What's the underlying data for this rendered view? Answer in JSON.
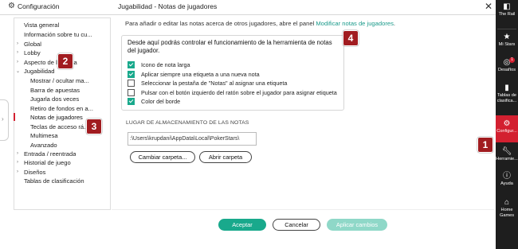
{
  "app": {
    "title": "Configuración",
    "gear_icon": "gear-icon"
  },
  "window": {
    "title": "Jugabilidad - Notas de jugadores",
    "close": "✕"
  },
  "sidebar": {
    "items": [
      {
        "label": "Vista general"
      },
      {
        "label": "Información sobre tu cu..."
      },
      {
        "label": "Global"
      },
      {
        "label": "Lobby"
      },
      {
        "label": "Aspecto de la mesa"
      },
      {
        "label": "Jugabilidad"
      },
      {
        "label": "Mostrar / ocultar ma..."
      },
      {
        "label": "Barra de apuestas"
      },
      {
        "label": "Jugarla dos veces"
      },
      {
        "label": "Retiro de fondos en a..."
      },
      {
        "label": "Notas de jugadores"
      },
      {
        "label": "Teclas de acceso rá..."
      },
      {
        "label": "Multimesa"
      },
      {
        "label": "Avanzado"
      },
      {
        "label": "Entrada / reentrada"
      },
      {
        "label": "Historial de juego"
      },
      {
        "label": "Diseños"
      },
      {
        "label": "Tablas de clasificación"
      }
    ]
  },
  "main": {
    "info_prefix": "Para añadir o editar las notas acerca de otros jugadores, abre el panel ",
    "info_link": "Modificar notas de jugadores",
    "info_suffix": ".",
    "box_description": "Desde aquí podrás controlar el funcionamiento de la herramienta de notas del jugador.",
    "options": [
      {
        "label": "Icono de nota larga",
        "checked": true
      },
      {
        "label": "Aplicar siempre una etiqueta a una nueva nota",
        "checked": true
      },
      {
        "label": "Seleccionar la pestaña de \"Notas\" al asignar una etiqueta",
        "checked": false
      },
      {
        "label": "Pulsar con el botón izquierdo del ratón sobre el jugador para asignar etiqueta",
        "checked": false
      },
      {
        "label": "Color del borde",
        "checked": true
      }
    ],
    "storage_label": "LUGAR DE ALMACENAMIENTO DE LAS NOTAS",
    "storage_path": ":\\Users\\krupdani\\AppData\\Local\\PokerStars\\",
    "change_folder": "Cambiar carpeta...",
    "open_folder": "Abrir carpeta"
  },
  "footer": {
    "accept": "Aceptar",
    "cancel": "Cancelar",
    "apply": "Aplicar cambios"
  },
  "rail": {
    "items": [
      {
        "label": "The Rail",
        "icon": "rail-icon"
      },
      {
        "label": "Mi Stars",
        "icon": "star-icon"
      },
      {
        "label": "Desafíos",
        "icon": "target-icon",
        "badge": "1"
      },
      {
        "label": "Tablas de clasifica...",
        "icon": "leaderboard-icon"
      },
      {
        "label": "Configur...",
        "icon": "gear-icon"
      },
      {
        "label": "Herramie...",
        "icon": "wrench-icon"
      },
      {
        "label": "Ayuda",
        "icon": "help-icon"
      },
      {
        "label": "Home Games",
        "icon": "home-games-icon"
      }
    ]
  },
  "callouts": [
    "1",
    "2",
    "3",
    "4"
  ],
  "colors": {
    "accent": "#19a98c",
    "rail_bg": "#1e1e1e",
    "selected_rail": "#d32030",
    "callout": "#a11c20"
  }
}
